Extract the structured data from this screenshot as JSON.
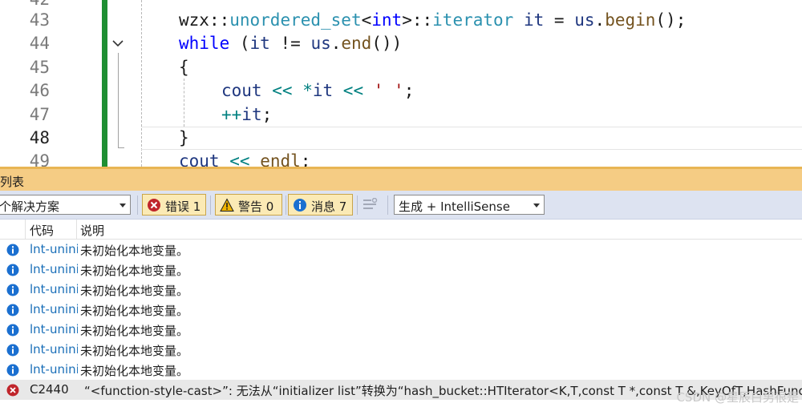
{
  "editor": {
    "line_numbers": [
      "42",
      "43",
      "44",
      "45",
      "46",
      "47",
      "48",
      "49"
    ],
    "current_line": "48",
    "lines": {
      "l43": {
        "ns": "wzx",
        "sep1": "::",
        "type": "unordered_set",
        "lt": "<",
        "targ": "int",
        "gt": ">",
        "sep2": "::",
        "iter": "iterator",
        "var": "it",
        "eq": "=",
        "obj": "us",
        "dot": ".",
        "fn": "begin",
        "tail": "();"
      },
      "l44": {
        "kw": "while",
        "open": "(",
        "var": "it",
        "op": "!=",
        "obj": "us",
        "dot": ".",
        "fn": "end",
        "tail": "())"
      },
      "l45": {
        "text": "{"
      },
      "l46": {
        "fn": "cout",
        "op1": "<<",
        "star": "*",
        "var": "it",
        "op2": "<<",
        "str": "' '",
        "semi": ";"
      },
      "l47": {
        "op": "++",
        "var": "it",
        "semi": ";"
      },
      "l48": {
        "text": "}"
      },
      "l49": {
        "fn": "cout",
        "op": "<<",
        "end": "endl",
        "semi": ";"
      }
    }
  },
  "error_list": {
    "title": "列表",
    "scope_value": "个解决方案",
    "errors_label": "错误 1",
    "warnings_label": "警告 0",
    "messages_label": "消息 7",
    "build_filter_value": "生成 + IntelliSense",
    "col_code": "代码",
    "col_desc": "说明",
    "rows": [
      {
        "severity": "info",
        "code": "lnt-uninit",
        "desc": "未初始化本地变量。"
      },
      {
        "severity": "info",
        "code": "lnt-uninit",
        "desc": "未初始化本地变量。"
      },
      {
        "severity": "info",
        "code": "lnt-uninit",
        "desc": "未初始化本地变量。"
      },
      {
        "severity": "info",
        "code": "lnt-uninit",
        "desc": "未初始化本地变量。"
      },
      {
        "severity": "info",
        "code": "lnt-uninit",
        "desc": "未初始化本地变量。"
      },
      {
        "severity": "info",
        "code": "lnt-uninit",
        "desc": "未初始化本地变量。"
      },
      {
        "severity": "info",
        "code": "lnt-uninit",
        "desc": "未初始化本地变量。"
      },
      {
        "severity": "error",
        "code": "C2440",
        "desc": "“<function-style-cast>”: 无法从“initializer list”转换为“hash_bucket::HTIterator<K,T,const T *,const T &,KeyOfT,HashFunc>”基"
      }
    ],
    "watermark": "CSDN @星辰白男很是"
  },
  "colors": {
    "change_bar": "#1e8f32",
    "panel_title_bg": "#f5cc84",
    "toolbar_bg": "#dde3f1",
    "button_bg": "#fbeab5",
    "error_red": "#c0252b",
    "warning_yellow": "#f0b400",
    "info_blue": "#1a6fd0"
  }
}
